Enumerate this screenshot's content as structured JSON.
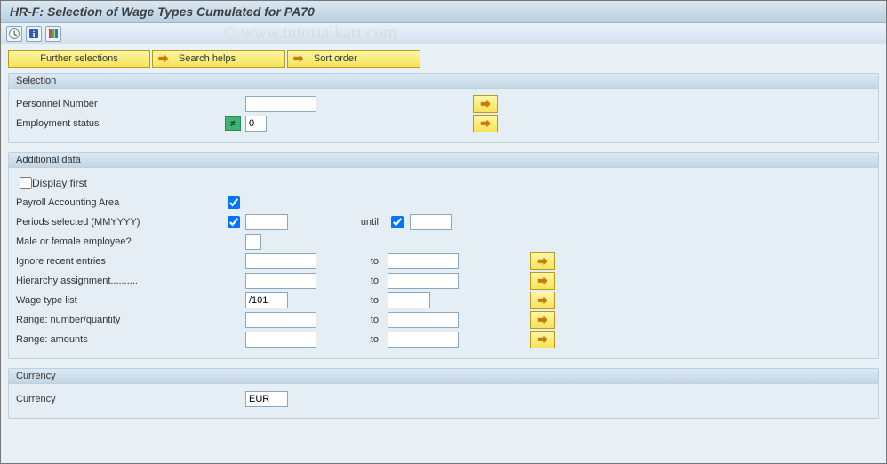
{
  "title": "HR-F: Selection of Wage Types Cumulated for PA70",
  "watermark": "© www.tutorialkart.com",
  "appbar": {
    "further_selections": "Further selections",
    "search_helps": "Search helps",
    "sort_order": "Sort order"
  },
  "groups": {
    "selection": {
      "title": "Selection",
      "personnel_number_label": "Personnel Number",
      "personnel_number_value": "",
      "employment_status_label": "Employment status",
      "employment_status_value": "0"
    },
    "additional": {
      "title": "Additional data",
      "display_first_label": "Display first",
      "display_first_checked": false,
      "payroll_area_label": "Payroll Accounting Area",
      "payroll_area_checked": true,
      "periods_label": "Periods selected (MMYYYY)",
      "periods_from_checked": true,
      "periods_from_value": "",
      "until_label": "until",
      "periods_to_checked": true,
      "periods_to_value": "",
      "gender_label": "Male or female employee?",
      "gender_value": "",
      "ignore_recent_label": "Ignore recent entries",
      "ignore_recent_from": "",
      "ignore_recent_to": "",
      "to_label": "to",
      "hierarchy_label": "Hierarchy assignment..........",
      "hierarchy_from": "",
      "hierarchy_to": "",
      "wagetype_label": "Wage type list",
      "wagetype_from": "/101",
      "wagetype_to": "",
      "range_qty_label": "Range: number/quantity",
      "range_qty_from": "",
      "range_qty_to": "",
      "range_amt_label": "Range: amounts",
      "range_amt_from": "",
      "range_amt_to": ""
    },
    "currency": {
      "title": "Currency",
      "label": "Currency",
      "value": "EUR"
    }
  }
}
